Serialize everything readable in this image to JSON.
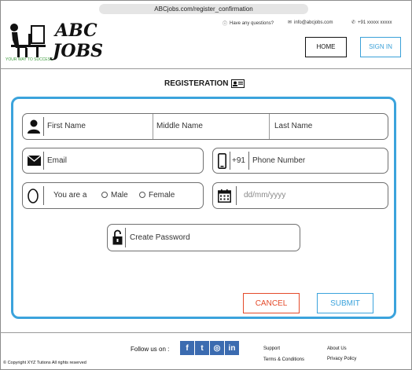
{
  "browser": {
    "url": "ABCjobs.com/register_confirmation"
  },
  "header": {
    "logo_line1": "ABC",
    "logo_line2": "JOBS",
    "logo_small_text": "ABC\nJOBS",
    "logo_tagline": "YOUR WAY TO SUCCESS",
    "contact_question": "Have any questions?",
    "contact_email": "info@abcjobs.com",
    "contact_phone": "+91 xxxxx xxxxx",
    "home_label": "HOME",
    "signin_label": "SIGN IN"
  },
  "form": {
    "title": "REGISTERATION",
    "first_name_placeholder": "First Name",
    "middle_name_placeholder": "Middle Name",
    "last_name_placeholder": "Last Name",
    "email_placeholder": "Email",
    "phone_prefix": "+91",
    "phone_placeholder": "Phone Number",
    "gender_label": "You are a",
    "gender_options": [
      "Male",
      "Female"
    ],
    "dob_placeholder": "dd/mm/yyyy",
    "password_placeholder": "Create Password",
    "cancel_label": "CANCEL",
    "submit_label": "SUBMIT"
  },
  "footer": {
    "follow_label": "Follow us on :",
    "social_icons": [
      "facebook-icon",
      "twitter-icon",
      "instagram-icon",
      "linkedin-icon"
    ],
    "social_glyphs": [
      "f",
      "t",
      "◎",
      "in"
    ],
    "links": [
      "Support",
      "About Us",
      "Terms & Conditions",
      "Privacy Policy"
    ],
    "copyright": "© Copyright XYZ Tutions All rights reserved"
  },
  "colors": {
    "accent": "#3ba3dc",
    "cancel": "#e44a2a",
    "social": "#3b6bb0",
    "logo_green": "#3a9a3a"
  }
}
